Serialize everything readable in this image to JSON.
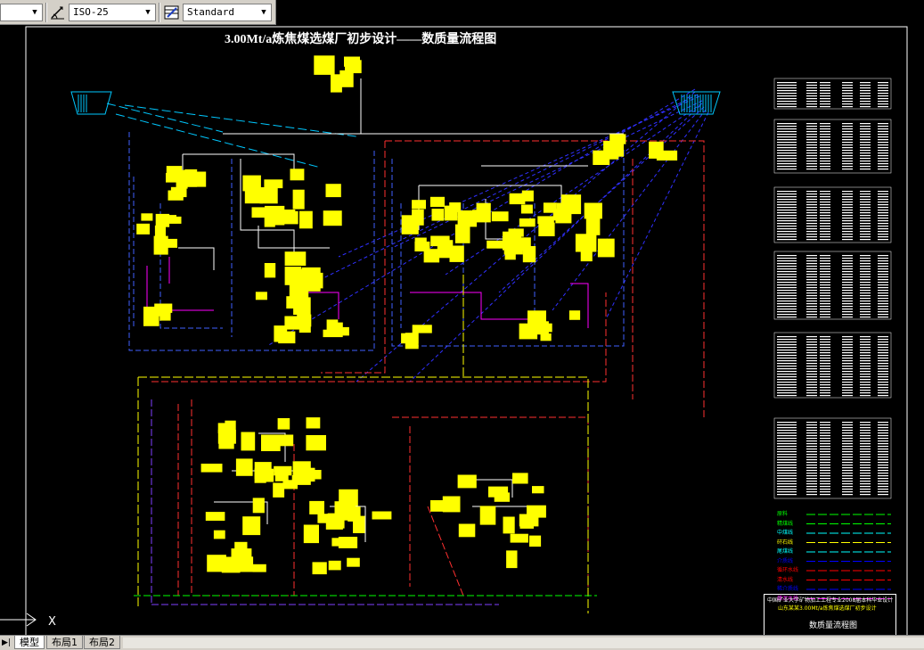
{
  "toolbar": {
    "dimstyle_value": "ISO-25",
    "textstyle_value": "Standard"
  },
  "drawing": {
    "title": "3.00Mt/a炼焦煤选煤厂初步设计——数质量流程图",
    "legend": [
      {
        "label": "原料",
        "color": "#00ff00"
      },
      {
        "label": "精煤线",
        "color": "#00ff00"
      },
      {
        "label": "中煤线",
        "color": "#00ffff"
      },
      {
        "label": "矸石线",
        "color": "#ffff00"
      },
      {
        "label": "尾煤线",
        "color": "#00ffff"
      },
      {
        "label": "介质线",
        "color": "#0000ff"
      },
      {
        "label": "循环水线",
        "color": "#ff0000"
      },
      {
        "label": "清水线",
        "color": "#ff0000"
      },
      {
        "label": "稀介质线",
        "color": "#0000ff"
      },
      {
        "label": "煤泥水线",
        "color": "#ff00ff"
      }
    ],
    "titleblock": {
      "org": "中国矿业大学矿物加工工程专业2008届本科毕业设计",
      "project": "山东某某3.00Mt/a炼焦煤选煤厂初步设计",
      "drawing_name": "数质量流程图"
    },
    "ucs_x": "X"
  },
  "tabs": [
    {
      "label": "模型",
      "active": true
    },
    {
      "label": "布局1",
      "active": false
    },
    {
      "label": "布局2",
      "active": false
    }
  ]
}
